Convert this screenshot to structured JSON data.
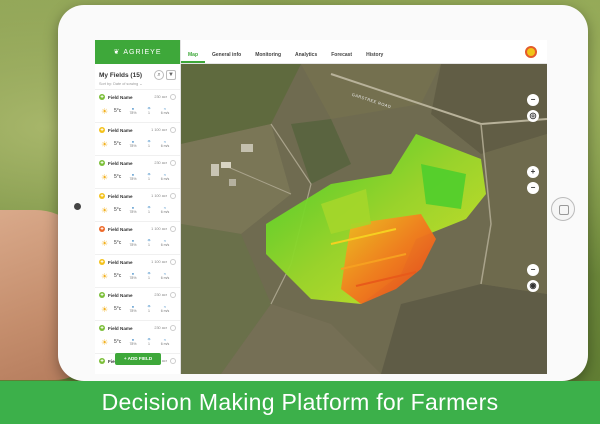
{
  "brand": {
    "name": "AGRIEYE"
  },
  "sidebar": {
    "title": "My Fields (15)",
    "sort_text": "Sort by: Date of sowing ⌄",
    "add_button": "+ ADD FIELD",
    "fields": [
      {
        "name": "Field Name",
        "size": "230 acr",
        "status_color": "#7cbf3a",
        "temp": "5°c",
        "humidity": "78%",
        "rain": "1",
        "wind": "6 m/s"
      },
      {
        "name": "Field Name",
        "size": "1 100 acr",
        "status_color": "#f4c21c",
        "temp": "5°c",
        "humidity": "78%",
        "rain": "1",
        "wind": "6 m/s"
      },
      {
        "name": "Field Name",
        "size": "230 acr",
        "status_color": "#7cbf3a",
        "temp": "5°c",
        "humidity": "78%",
        "rain": "1",
        "wind": "6 m/s"
      },
      {
        "name": "Field Name",
        "size": "1 100 acr",
        "status_color": "#f4c21c",
        "temp": "5°c",
        "humidity": "78%",
        "rain": "1",
        "wind": "6 m/s"
      },
      {
        "name": "Field Name",
        "size": "1 100 acr",
        "status_color": "#ee6a2b",
        "temp": "5°c",
        "humidity": "78%",
        "rain": "1",
        "wind": "6 m/s"
      },
      {
        "name": "Field Name",
        "size": "1 100 acr",
        "status_color": "#f4c21c",
        "temp": "5°c",
        "humidity": "78%",
        "rain": "1",
        "wind": "6 m/s"
      },
      {
        "name": "Field Name",
        "size": "230 acr",
        "status_color": "#7cbf3a",
        "temp": "5°c",
        "humidity": "78%",
        "rain": "1",
        "wind": "6 m/s"
      },
      {
        "name": "Field Name",
        "size": "230 acr",
        "status_color": "#7cbf3a",
        "temp": "5°c",
        "humidity": "78%",
        "rain": "1",
        "wind": "6 m/s"
      },
      {
        "name": "Field Name",
        "size": "230 acr",
        "status_color": "#7cbf3a",
        "temp": "",
        "humidity": "",
        "rain": "",
        "wind": ""
      }
    ]
  },
  "nav": {
    "tabs": [
      "Map",
      "General info",
      "Monitoring",
      "Analytics",
      "Forecast",
      "History"
    ],
    "active_tab": "Map"
  },
  "map": {
    "road_label": "GARSTREE ROAD"
  },
  "caption": "Decision Making Platform for Farmers",
  "colors": {
    "accent": "#3ea83a",
    "caption_bg": "#3cb04a"
  }
}
